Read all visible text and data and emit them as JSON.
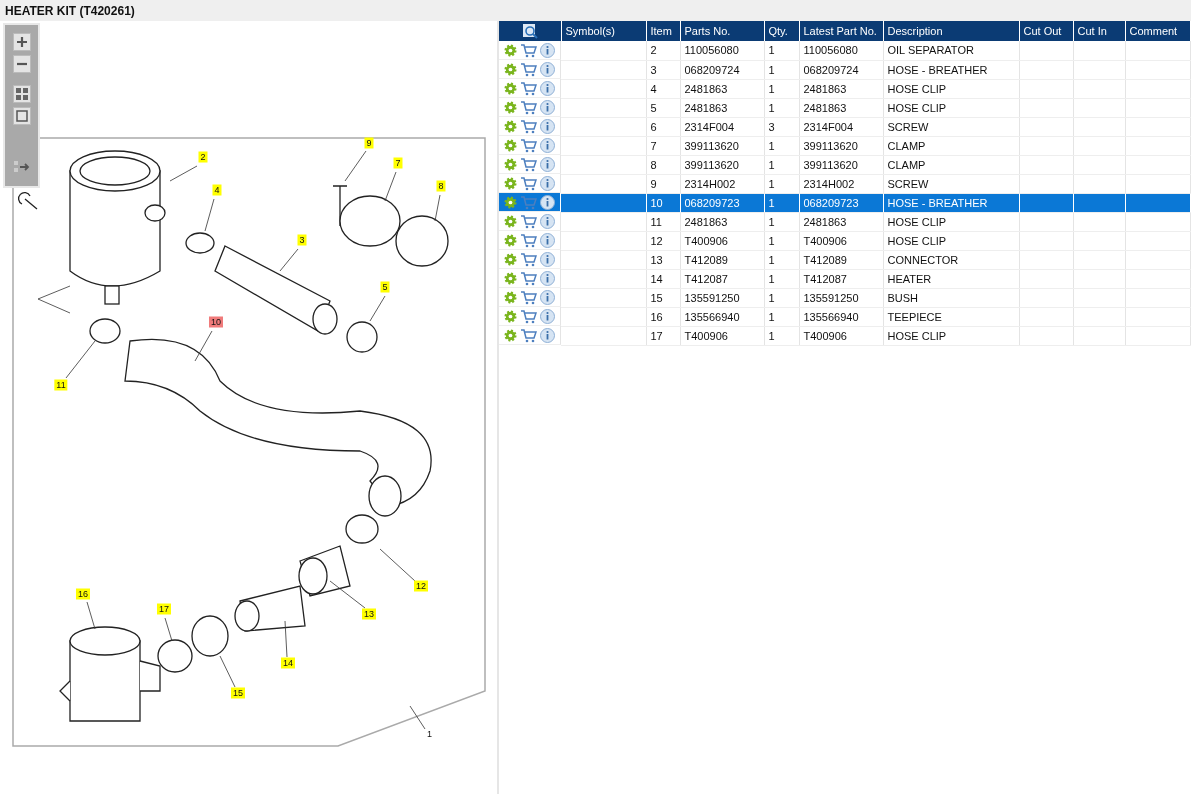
{
  "window": {
    "title": "HEATER KIT (T420261)"
  },
  "diagram": {
    "callouts": [
      {
        "label": "2",
        "selected": false
      },
      {
        "label": "4",
        "selected": false
      },
      {
        "label": "3",
        "selected": false
      },
      {
        "label": "9",
        "selected": false
      },
      {
        "label": "7",
        "selected": false
      },
      {
        "label": "8",
        "selected": false
      },
      {
        "label": "5",
        "selected": false
      },
      {
        "label": "10",
        "selected": true
      },
      {
        "label": "11",
        "selected": false
      },
      {
        "label": "12",
        "selected": false
      },
      {
        "label": "13",
        "selected": false
      },
      {
        "label": "14",
        "selected": false
      },
      {
        "label": "16",
        "selected": false
      },
      {
        "label": "17",
        "selected": false
      },
      {
        "label": "15",
        "selected": false
      }
    ],
    "frame_label": "1"
  },
  "table": {
    "columns": [
      "Symbol(s)",
      "Item",
      "Parts No.",
      "Qty.",
      "Latest Part No.",
      "Description",
      "Cut Out",
      "Cut In",
      "Comment"
    ],
    "rows": [
      {
        "item": "2",
        "parts_no": "110056080",
        "qty": "1",
        "latest": "110056080",
        "description": "OIL SEPARATOR",
        "selected": false
      },
      {
        "item": "3",
        "parts_no": "068209724",
        "qty": "1",
        "latest": "068209724",
        "description": "HOSE - BREATHER",
        "selected": false
      },
      {
        "item": "4",
        "parts_no": "2481863",
        "qty": "1",
        "latest": "2481863",
        "description": "HOSE CLIP",
        "selected": false
      },
      {
        "item": "5",
        "parts_no": "2481863",
        "qty": "1",
        "latest": "2481863",
        "description": "HOSE CLIP",
        "selected": false
      },
      {
        "item": "6",
        "parts_no": "2314F004",
        "qty": "3",
        "latest": "2314F004",
        "description": "SCREW",
        "selected": false
      },
      {
        "item": "7",
        "parts_no": "399113620",
        "qty": "1",
        "latest": "399113620",
        "description": "CLAMP",
        "selected": false
      },
      {
        "item": "8",
        "parts_no": "399113620",
        "qty": "1",
        "latest": "399113620",
        "description": "CLAMP",
        "selected": false
      },
      {
        "item": "9",
        "parts_no": "2314H002",
        "qty": "1",
        "latest": "2314H002",
        "description": "SCREW",
        "selected": false
      },
      {
        "item": "10",
        "parts_no": "068209723",
        "qty": "1",
        "latest": "068209723",
        "description": "HOSE - BREATHER",
        "selected": true
      },
      {
        "item": "11",
        "parts_no": "2481863",
        "qty": "1",
        "latest": "2481863",
        "description": "HOSE CLIP",
        "selected": false
      },
      {
        "item": "12",
        "parts_no": "T400906",
        "qty": "1",
        "latest": "T400906",
        "description": "HOSE CLIP",
        "selected": false
      },
      {
        "item": "13",
        "parts_no": "T412089",
        "qty": "1",
        "latest": "T412089",
        "description": "CONNECTOR",
        "selected": false
      },
      {
        "item": "14",
        "parts_no": "T412087",
        "qty": "1",
        "latest": "T412087",
        "description": "HEATER",
        "selected": false
      },
      {
        "item": "15",
        "parts_no": "135591250",
        "qty": "1",
        "latest": "135591250",
        "description": "BUSH",
        "selected": false
      },
      {
        "item": "16",
        "parts_no": "135566940",
        "qty": "1",
        "latest": "135566940",
        "description": "TEEPIECE",
        "selected": false
      },
      {
        "item": "17",
        "parts_no": "T400906",
        "qty": "1",
        "latest": "T400906",
        "description": "HOSE CLIP",
        "selected": false
      }
    ]
  }
}
